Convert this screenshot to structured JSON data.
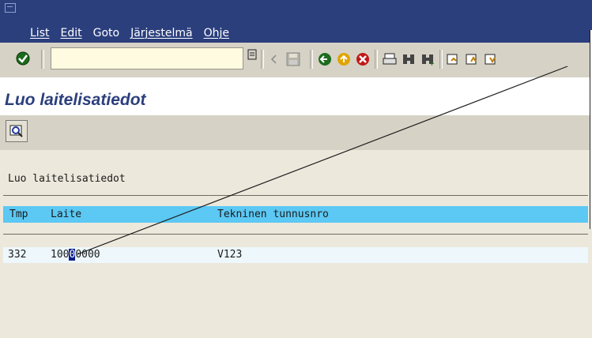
{
  "window": {
    "system_icon": "window-menu-icon"
  },
  "menu": [
    "List",
    "Edit",
    "Goto",
    "Järjestelmä",
    "Ohje"
  ],
  "toolbar": {
    "command_field_value": "",
    "icons": [
      "enter-icon",
      "command-field-dropdown-icon",
      "back-arrow-icon",
      "save-icon",
      "back-icon",
      "exit-icon",
      "cancel-icon",
      "print-icon",
      "find-icon",
      "find-next-icon",
      "first-page-icon",
      "previous-page-icon",
      "next-page-icon"
    ]
  },
  "title": "Luo laitelisatiedot",
  "app_toolbar": {
    "icons": [
      "detail-icon"
    ]
  },
  "list": {
    "title": "Luo laitelisatiedot",
    "columns": [
      "Tmp",
      "Laite",
      "Tekninen tunnusnro"
    ],
    "rows": [
      {
        "tmp": "332",
        "laite": "10000000",
        "tekninen": "V123"
      }
    ]
  },
  "colors": {
    "menubar": "#2b3f7d",
    "header_row": "#5cc8f4",
    "title_text": "#2b3f7d",
    "cursor": "#0a1e8c"
  }
}
